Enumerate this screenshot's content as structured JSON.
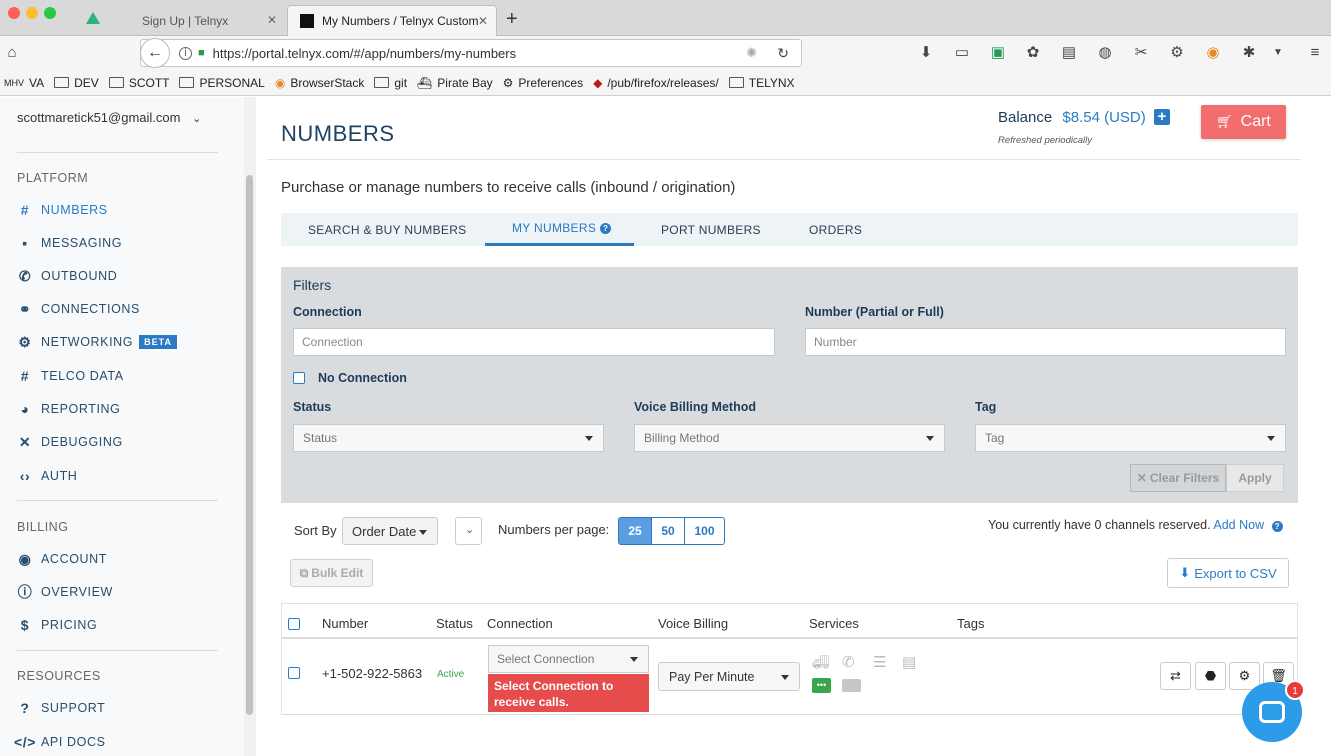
{
  "browser": {
    "tabs": [
      {
        "title": "Sign Up | Telnyx"
      },
      {
        "title": "My Numbers / Telnyx Custom"
      }
    ],
    "url": "https://portal.telnyx.com/#/app/numbers/my-numbers",
    "bookmarks": [
      "VA",
      "DEV",
      "SCOTT",
      "PERSONAL",
      "BrowserStack",
      "git",
      "Pirate Bay",
      "Preferences",
      "/pub/firefox/releases/",
      "TELYNX"
    ]
  },
  "sidebar": {
    "email": "scottmaretick51@gmail.com",
    "sections": {
      "platform": "PLATFORM",
      "billing": "BILLING",
      "resources": "RESOURCES"
    },
    "items": {
      "numbers": "NUMBERS",
      "messaging": "MESSAGING",
      "outbound": "OUTBOUND",
      "connections": "CONNECTIONS",
      "networking": "NETWORKING",
      "beta": "BETA",
      "telco_data": "TELCO DATA",
      "reporting": "REPORTING",
      "debugging": "DEBUGGING",
      "auth": "AUTH",
      "account": "ACCOUNT",
      "overview": "OVERVIEW",
      "pricing": "PRICING",
      "support": "SUPPORT",
      "api_docs": "API DOCS"
    }
  },
  "header": {
    "title": "NUMBERS",
    "balance_label": "Balance",
    "balance_amount": "$8.54 (USD)",
    "refreshed": "Refreshed periodically",
    "cart": "Cart"
  },
  "subtitle": "Purchase or manage numbers to receive calls (inbound / origination)",
  "tabs": {
    "search_buy": "SEARCH & BUY NUMBERS",
    "my_numbers": "MY NUMBERS",
    "port": "PORT NUMBERS",
    "orders": "ORDERS"
  },
  "filters": {
    "title": "Filters",
    "connection_label": "Connection",
    "connection_placeholder": "Connection",
    "number_label": "Number (Partial or Full)",
    "number_placeholder": "Number",
    "no_connection": "No Connection",
    "status_label": "Status",
    "status_placeholder": "Status",
    "billing_label": "Voice Billing Method",
    "billing_placeholder": "Billing Method",
    "tag_label": "Tag",
    "tag_placeholder": "Tag",
    "clear": "Clear Filters",
    "apply": "Apply"
  },
  "controls": {
    "sort_by": "Sort By",
    "sort_value": "Order Date",
    "per_page_label": "Numbers per page:",
    "per_page_options": [
      "25",
      "50",
      "100"
    ],
    "channels_text": "You currently have 0 channels reserved.",
    "add_now": "Add Now",
    "bulk_edit": "Bulk Edit",
    "export_csv": "Export to CSV"
  },
  "table": {
    "headers": {
      "number": "Number",
      "status": "Status",
      "connection": "Connection",
      "voice_billing": "Voice Billing",
      "services": "Services",
      "tags": "Tags"
    },
    "rows": [
      {
        "number": "+1-502-922-5863",
        "status": "Active",
        "connection_placeholder": "Select Connection",
        "connection_error": "Select Connection to receive calls.",
        "voice_billing": "Pay Per Minute"
      }
    ]
  },
  "chat": {
    "badge": "1"
  },
  "colors": {
    "accent": "#2b7bc4",
    "cart": "#f26d6d",
    "error": "#e74c4c",
    "active": "#3aa54b",
    "chat": "#2c9be8"
  }
}
